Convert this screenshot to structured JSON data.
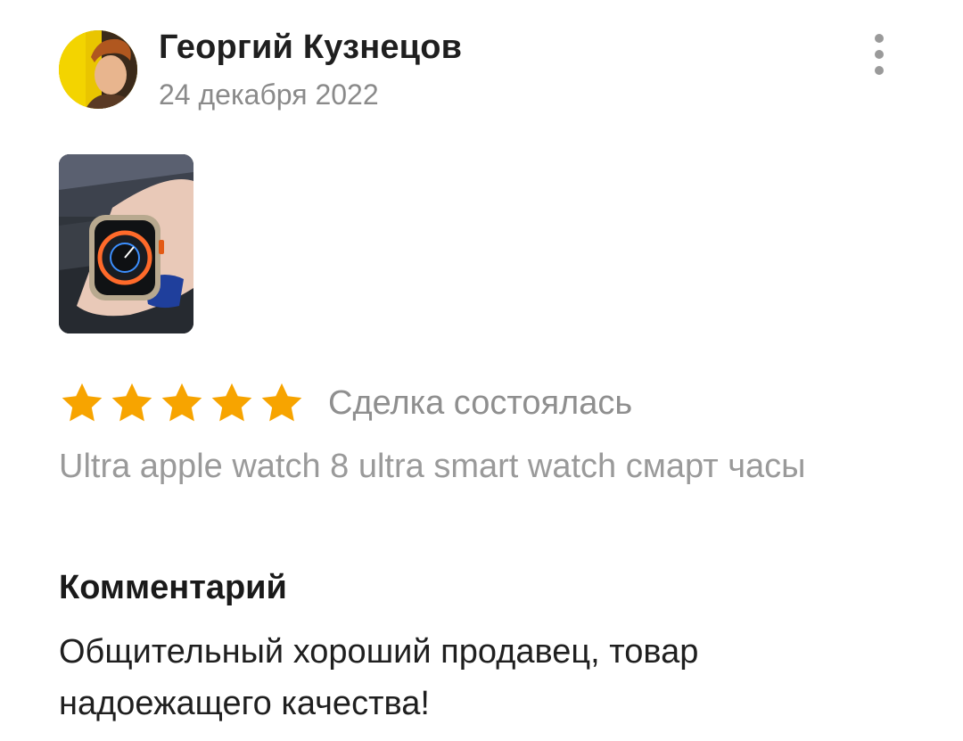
{
  "review": {
    "author_name": "Георгий Кузнецов",
    "date": "24 декабря 2022",
    "avatar_icon": "user-avatar-photo",
    "more_icon": "more-vertical-icon",
    "rating": 5,
    "rating_max": 5,
    "deal_status": "Сделка состоялась",
    "product_title": "Ultra apple watch 8 ultra smart watch смарт часы",
    "comment_heading": "Комментарий",
    "comment_text": "Общительный хороший продавец, товар надоежащего качества!"
  },
  "colors": {
    "star": "#f7a400",
    "muted_text": "#8f8f8f",
    "primary_text": "#1a1a1a"
  }
}
